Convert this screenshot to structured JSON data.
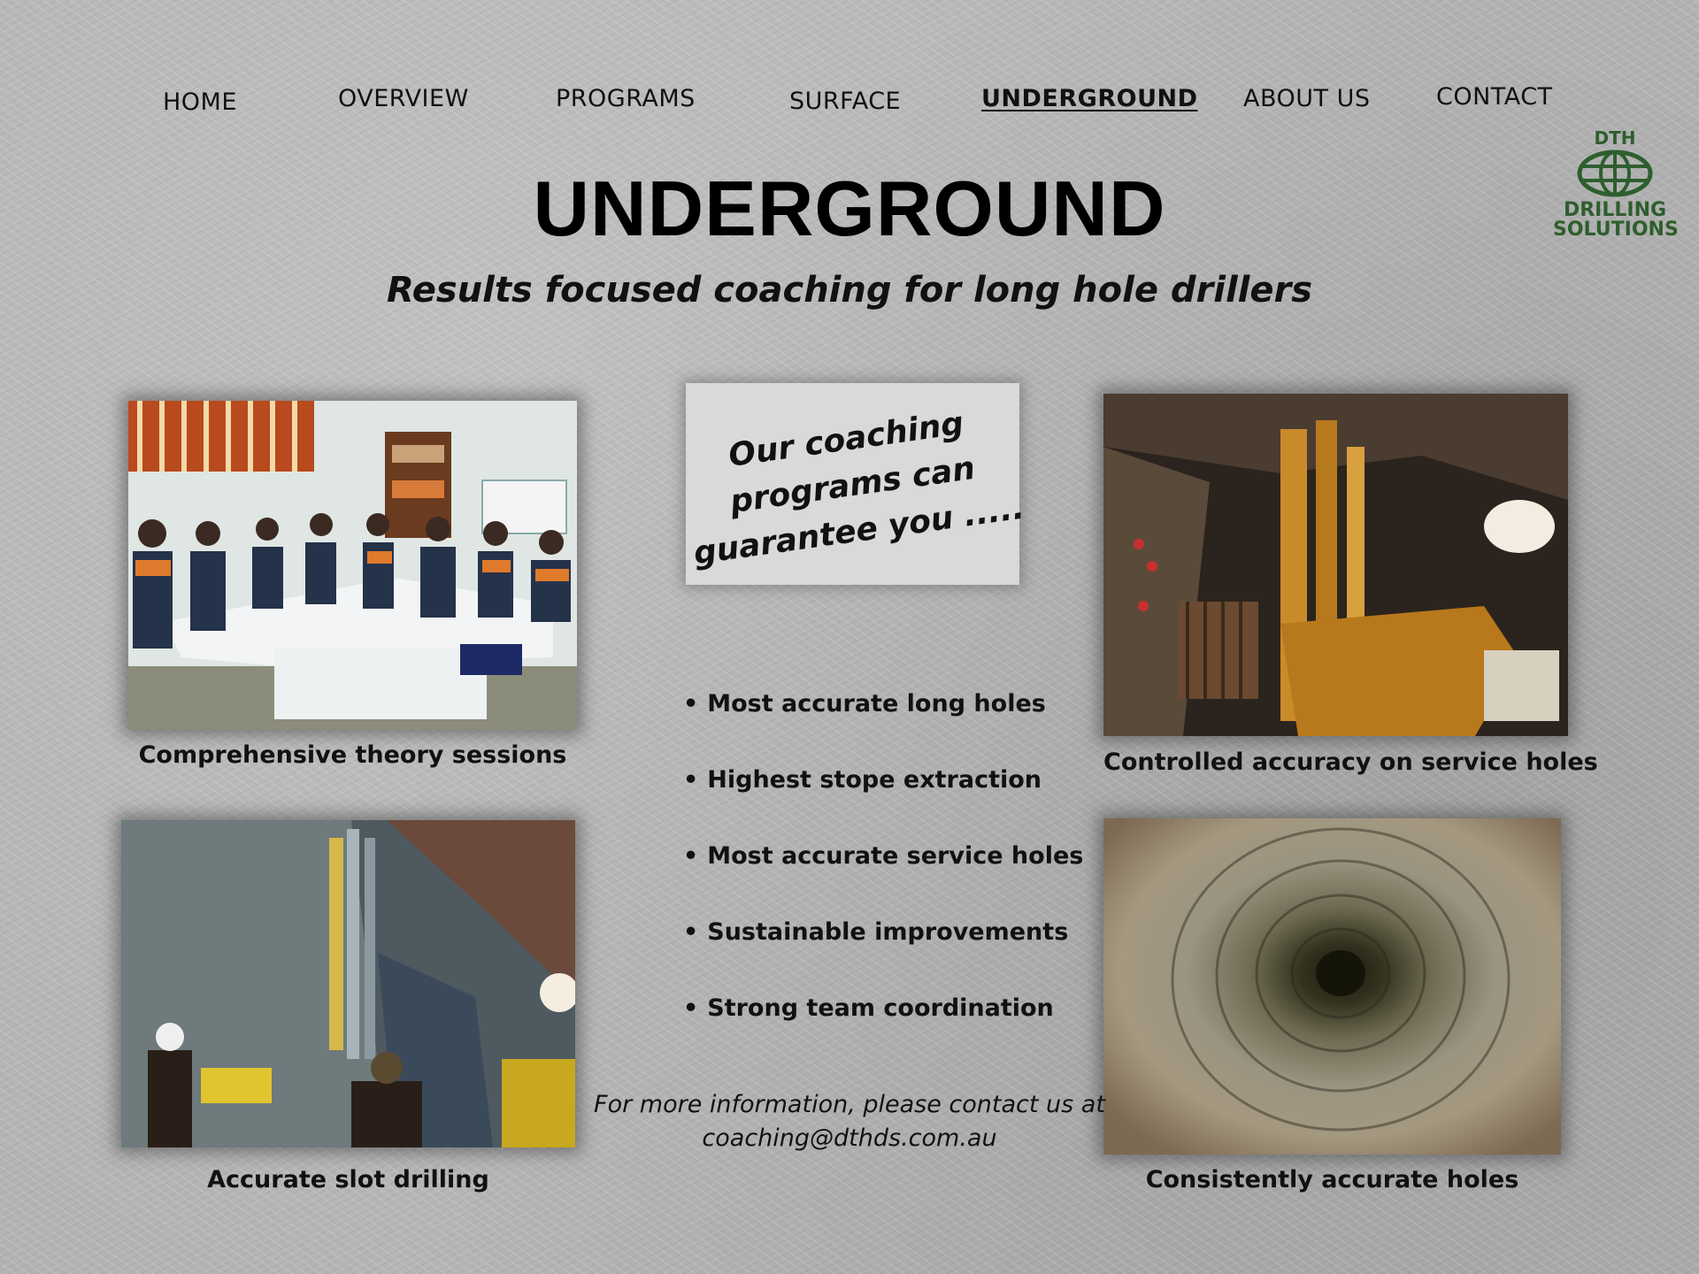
{
  "nav": {
    "items": [
      {
        "label": "HOME",
        "active": false
      },
      {
        "label": "OVERVIEW",
        "active": false
      },
      {
        "label": "PROGRAMS",
        "active": false
      },
      {
        "label": "SURFACE",
        "active": false
      },
      {
        "label": "UNDERGROUND",
        "active": true
      },
      {
        "label": "ABOUT US",
        "active": false
      },
      {
        "label": "CONTACT",
        "active": false
      }
    ]
  },
  "logo": {
    "line1": "DTH",
    "line2": "DRILLING",
    "line3": "SOLUTIONS",
    "icon": "globe-icon",
    "color": "#2e5e2e"
  },
  "header": {
    "title": "UNDERGROUND",
    "subtitle": "Results focused coaching for long hole drillers"
  },
  "card": {
    "line1": "Our coaching",
    "line2": "programs can",
    "line3": "guarantee you ....."
  },
  "bullets": [
    "Most accurate long holes",
    "Highest stope extraction",
    "Most accurate service holes",
    "Sustainable improvements",
    "Strong team coordination"
  ],
  "bullet_symbol": "•",
  "contact": {
    "line1": "For more information, please contact us at",
    "email": "coaching@dthds.com.au"
  },
  "photos": {
    "theory": {
      "caption": "Comprehensive theory sessions"
    },
    "service": {
      "caption": "Controlled accuracy on service holes"
    },
    "slot": {
      "caption": "Accurate slot drilling"
    },
    "holes": {
      "caption": "Consistently accurate holes"
    }
  },
  "colors": {
    "background": "#b3b3b3",
    "text": "#111111",
    "card": "#d9d9d9",
    "logo": "#2e5e2e"
  }
}
